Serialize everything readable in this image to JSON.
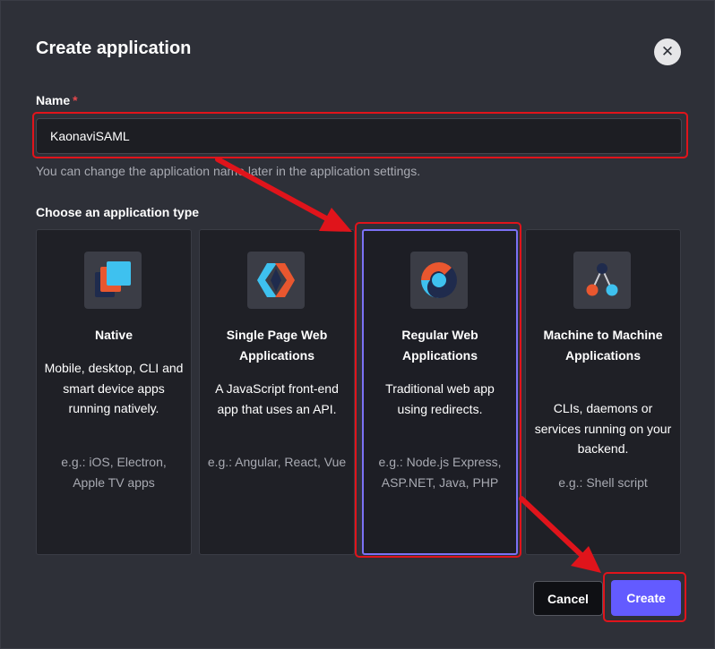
{
  "dialog": {
    "title": "Create application",
    "close_icon": "close-icon"
  },
  "name_field": {
    "label": "Name",
    "required_marker": "*",
    "value": "KaonaviSAML",
    "helper": "You can change the application name later in the application settings."
  },
  "app_type": {
    "label": "Choose an application type",
    "selected": "Regular Web Applications",
    "cards": [
      {
        "icon": "native-app-icon",
        "title": "Native",
        "description": "Mobile, desktop, CLI and smart device apps running natively.",
        "examples": "e.g.: iOS, Electron, Apple TV apps"
      },
      {
        "icon": "spa-icon",
        "title": "Single Page Web Applications",
        "description": "A JavaScript front-end app that uses an API.",
        "examples": "e.g.: Angular, React, Vue"
      },
      {
        "icon": "regular-web-app-icon",
        "title": "Regular Web Applications",
        "description": "Traditional web app using redirects.",
        "examples": "e.g.: Node.js Express, ASP.NET, Java, PHP"
      },
      {
        "icon": "machine-to-machine-icon",
        "title": "Machine to Machine Applications",
        "description": "CLIs, daemons or services running on your backend.",
        "examples": "e.g.: Shell script"
      }
    ]
  },
  "footer": {
    "cancel_label": "Cancel",
    "create_label": "Create"
  },
  "colors": {
    "accent": "#635bff",
    "selected_border": "#7b71f5",
    "annotation": "#e0141b",
    "required": "#e5484d"
  }
}
